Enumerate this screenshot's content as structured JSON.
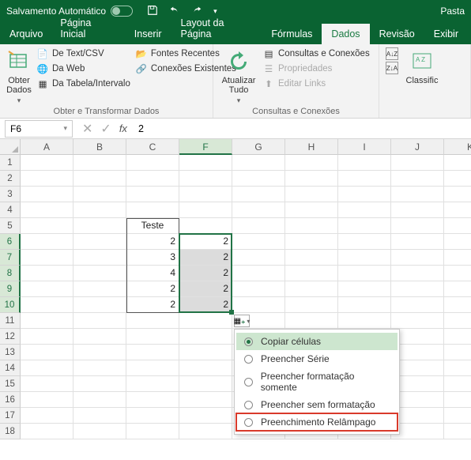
{
  "titlebar": {
    "autosave": "Salvamento Automático",
    "doc": "Pasta"
  },
  "menu": {
    "file": "Arquivo",
    "home": "Página Inicial",
    "insert": "Inserir",
    "layout": "Layout da Página",
    "formulas": "Fórmulas",
    "data": "Dados",
    "review": "Revisão",
    "view": "Exibir"
  },
  "ribbon": {
    "obter": {
      "get_data": "Obter Dados",
      "text_csv": "De Text/CSV",
      "web": "Da Web",
      "table": "Da Tabela/Intervalo",
      "recent": "Fontes Recentes",
      "existing": "Conexões Existentes",
      "group_label": "Obter e Transformar Dados"
    },
    "queries": {
      "refresh": "Atualizar Tudo",
      "connections": "Consultas e Conexões",
      "properties": "Propriedades",
      "edit_links": "Editar Links",
      "group_label": "Consultas e Conexões"
    },
    "sort": {
      "classify": "Classific"
    }
  },
  "formulabar": {
    "namebox": "F6",
    "value": "2"
  },
  "grid": {
    "columns": [
      "A",
      "B",
      "C",
      "F",
      "G",
      "H",
      "I",
      "J",
      "K"
    ],
    "rows": [
      "1",
      "2",
      "3",
      "4",
      "5",
      "6",
      "7",
      "8",
      "9",
      "10",
      "11",
      "12",
      "13",
      "14",
      "15",
      "16",
      "17",
      "18"
    ],
    "c_header": "Teste",
    "c_values": [
      "2",
      "3",
      "4",
      "2",
      "2"
    ],
    "f_values": [
      "2",
      "2",
      "2",
      "2",
      "2"
    ]
  },
  "autofill": {
    "copy": "Copiar células",
    "series": "Preencher Série",
    "fmt_only": "Preencher formatação somente",
    "no_fmt": "Preencher sem formatação",
    "flash": "Preenchimento Relâmpago"
  }
}
